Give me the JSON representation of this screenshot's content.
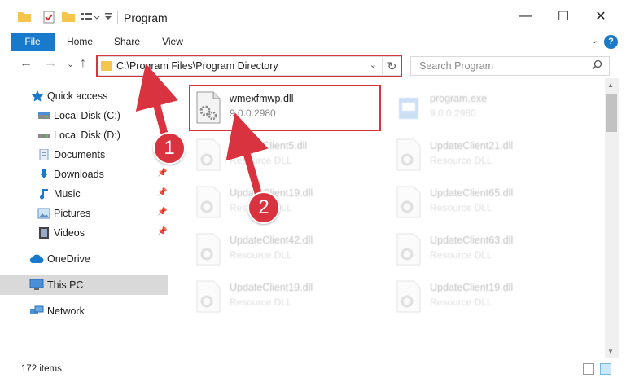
{
  "window": {
    "title": "Program",
    "minimize": "—",
    "maximize": "☐",
    "close": "✕"
  },
  "ribbon": {
    "tabs": [
      "File",
      "Home",
      "Share",
      "View"
    ],
    "help": "?"
  },
  "navigation": {
    "back": "←",
    "forward": "→",
    "recent": "⌄",
    "up": "↑",
    "address": "C:\\Program Files\\Program Directory",
    "refresh": "↻",
    "search_placeholder": "Search Program"
  },
  "sidebar": {
    "items": [
      {
        "label": "Quick access",
        "icon": "star-icon",
        "pinned": false
      },
      {
        "label": "Local Disk (C:)",
        "icon": "drive-icon",
        "pinned": false
      },
      {
        "label": "Local Disk (D:)",
        "icon": "drive-icon",
        "pinned": false
      },
      {
        "label": "Documents",
        "icon": "documents-icon",
        "pinned": false
      },
      {
        "label": "Downloads",
        "icon": "download-icon",
        "pinned": true
      },
      {
        "label": "Music",
        "icon": "music-icon",
        "pinned": true
      },
      {
        "label": "Pictures",
        "icon": "pictures-icon",
        "pinned": true
      },
      {
        "label": "Videos",
        "icon": "video-icon",
        "pinned": true
      },
      {
        "label": "OneDrive",
        "icon": "cloud-icon",
        "pinned": false
      },
      {
        "label": "This PC",
        "icon": "computer-icon",
        "pinned": false,
        "selected": true
      },
      {
        "label": "Network",
        "icon": "network-icon",
        "pinned": false
      }
    ]
  },
  "files": [
    {
      "name": "wmexfmwp.dll",
      "detail": "9.0.0.2980",
      "highlighted": true
    },
    {
      "name": "program.exe",
      "detail": "9.0.0.2980"
    },
    {
      "name": "UpdateClient5.dll",
      "detail": "Resource DLL"
    },
    {
      "name": "UpdateClient21.dll",
      "detail": "Resource DLL"
    },
    {
      "name": "UpdateClient19.dll",
      "detail": "Resource DLL"
    },
    {
      "name": "UpdateClient65.dll",
      "detail": "Resource DLL"
    },
    {
      "name": "UpdateClient42.dll",
      "detail": "Resource DLL"
    },
    {
      "name": "UpdateClient63.dll",
      "detail": "Resource DLL"
    },
    {
      "name": "UpdateClient19.dll",
      "detail": "Resource DLL"
    },
    {
      "name": "UpdateClient19.dll",
      "detail": "Resource DLL"
    }
  ],
  "status": {
    "item_count": "172 items"
  },
  "annotations": {
    "step1": "1",
    "step2": "2"
  },
  "colors": {
    "accent": "#1979ca",
    "annotation_red": "#d9333f",
    "folder_yellow": "#f5c64b"
  }
}
